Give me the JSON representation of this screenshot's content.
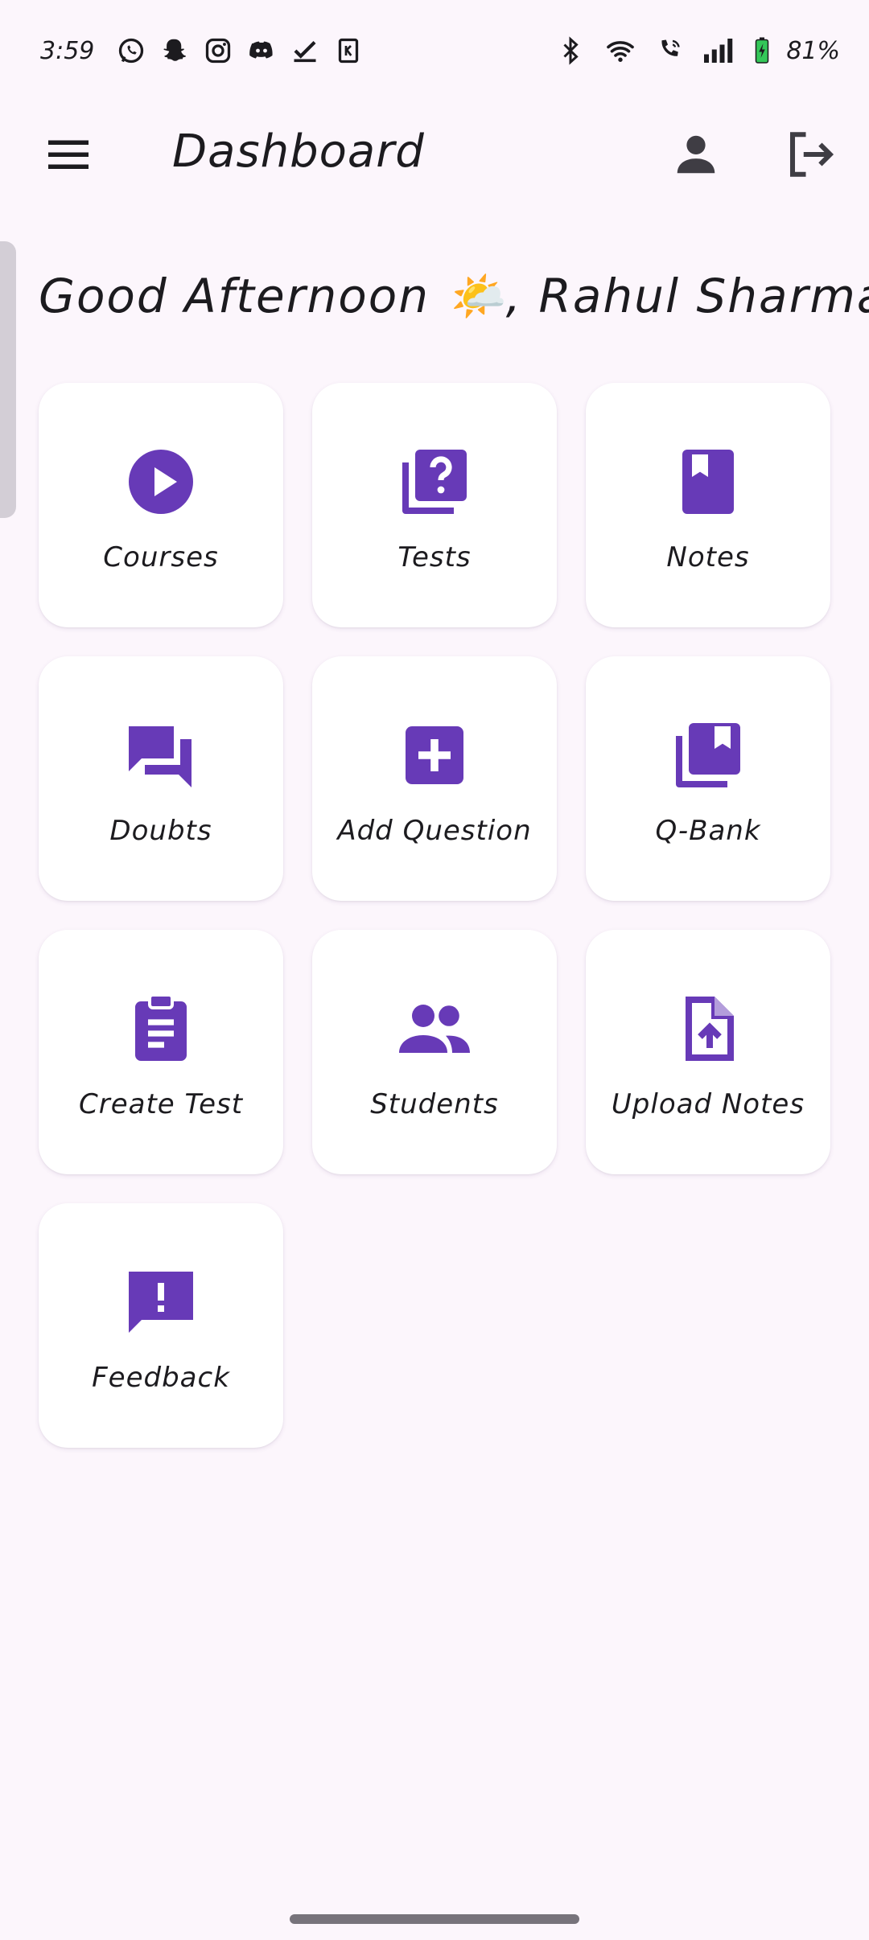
{
  "status_bar": {
    "time": "3:59",
    "battery_percent": "81%",
    "left_icons": [
      "whatsapp-icon",
      "snapchat-icon",
      "instagram-icon",
      "discord-icon",
      "check-icon",
      "k-app-icon"
    ],
    "right_icons": [
      "bluetooth-icon",
      "wifi-icon",
      "wifi-call-icon",
      "signal-icon",
      "battery-charging-icon"
    ]
  },
  "app_bar": {
    "title": "Dashboard",
    "menu_icon": "menu-icon",
    "profile_icon": "person-icon",
    "logout_icon": "logout-icon"
  },
  "greeting": {
    "text": "Good Afternoon 🌤️, Rahul Sharma"
  },
  "tiles": [
    {
      "label": "Courses",
      "icon": "play-circle-icon"
    },
    {
      "label": "Tests",
      "icon": "quiz-icon"
    },
    {
      "label": "Notes",
      "icon": "book-icon"
    },
    {
      "label": "Doubts",
      "icon": "forum-icon"
    },
    {
      "label": "Add Question",
      "icon": "add-box-icon"
    },
    {
      "label": "Q-Bank",
      "icon": "library-books-icon"
    },
    {
      "label": "Create Test",
      "icon": "assignment-icon"
    },
    {
      "label": "Students",
      "icon": "people-icon"
    },
    {
      "label": "Upload Notes",
      "icon": "upload-file-icon"
    },
    {
      "label": "Feedback",
      "icon": "feedback-icon"
    }
  ],
  "colors": {
    "background": "#fcf6fc",
    "accent": "#673ab7",
    "text": "#1c1b1f",
    "battery_green": "#34c759"
  }
}
